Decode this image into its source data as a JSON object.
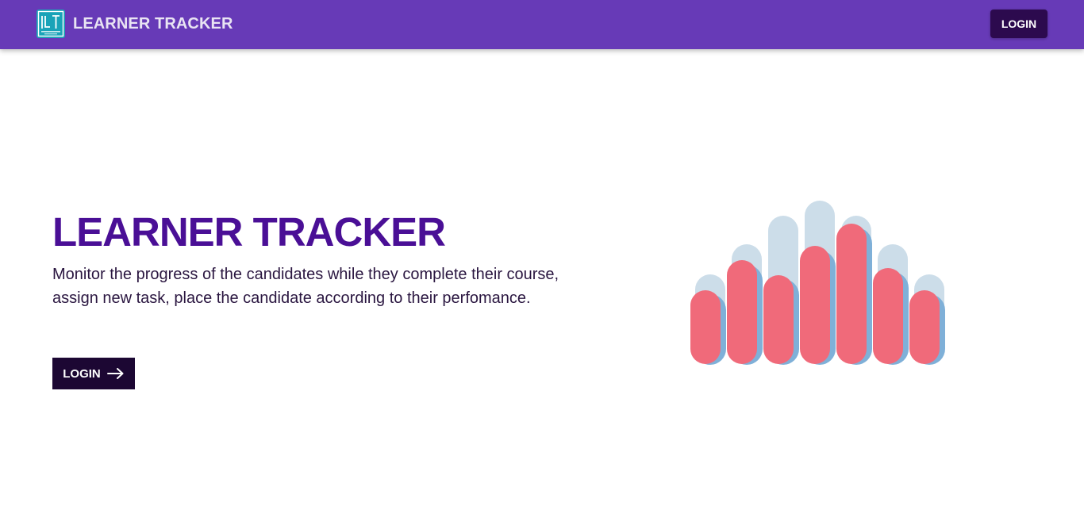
{
  "appbar": {
    "brand": "LEARNER TRACKER",
    "logo_icon": "ict-logo-icon",
    "login_label": "LOGIN",
    "color": "#673ab7"
  },
  "hero": {
    "title": "LEARNER TRACKER",
    "description": "Monitor the progress of the candidates while they complete their course, assign new task, place the candidate according to their perfomance.",
    "login_label": "LOGIN",
    "login_icon": "arrow-right-icon",
    "title_color": "#4a0f96"
  },
  "illustration": {
    "icon": "bar-graph-illustration-icon",
    "colors": {
      "bar": "#f06a7a",
      "shadow": "#7fb0d8",
      "background": "#ccdde9"
    }
  }
}
